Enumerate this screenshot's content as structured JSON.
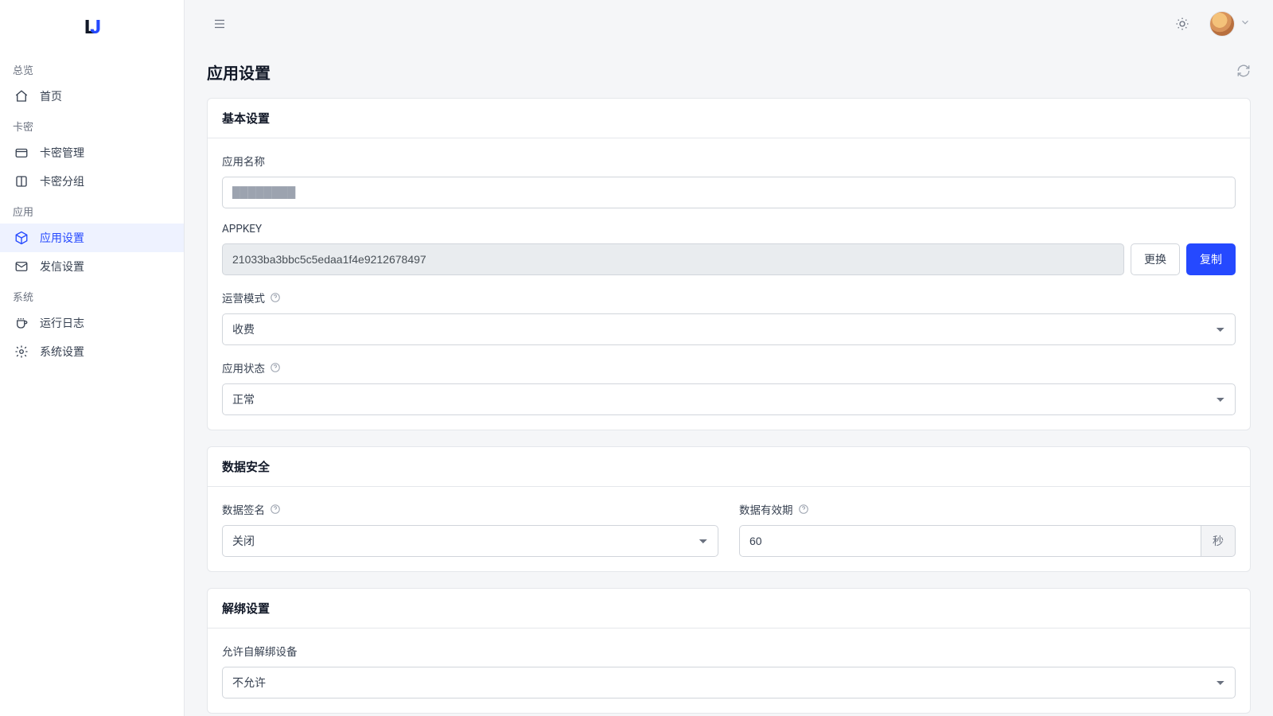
{
  "sidebar": {
    "sections": [
      {
        "header": "总览",
        "items": [
          {
            "label": "首页",
            "icon": "home"
          }
        ]
      },
      {
        "header": "卡密",
        "items": [
          {
            "label": "卡密管理",
            "icon": "card"
          },
          {
            "label": "卡密分组",
            "icon": "columns"
          }
        ]
      },
      {
        "header": "应用",
        "items": [
          {
            "label": "应用设置",
            "icon": "cube",
            "active": true
          },
          {
            "label": "发信设置",
            "icon": "mail"
          }
        ]
      },
      {
        "header": "系统",
        "items": [
          {
            "label": "运行日志",
            "icon": "cup"
          },
          {
            "label": "系统设置",
            "icon": "gear"
          }
        ]
      }
    ]
  },
  "page": {
    "title": "应用设置"
  },
  "basic": {
    "card_title": "基本设置",
    "app_name_label": "应用名称",
    "app_name_value": "████████",
    "appkey_label": "APPKEY",
    "appkey_value": "21033ba3bbc5c5edaa1f4e9212678497",
    "btn_replace": "更换",
    "btn_copy": "复制",
    "mode_label": "运营模式",
    "mode_value": "收费",
    "status_label": "应用状态",
    "status_value": "正常"
  },
  "security": {
    "card_title": "数据安全",
    "sign_label": "数据签名",
    "sign_value": "关闭",
    "expiry_label": "数据有效期",
    "expiry_value": "60",
    "expiry_unit": "秒"
  },
  "unbind": {
    "card_title": "解绑设置",
    "self_unbind_label": "允许自解绑设备",
    "self_unbind_value": "不允许"
  }
}
